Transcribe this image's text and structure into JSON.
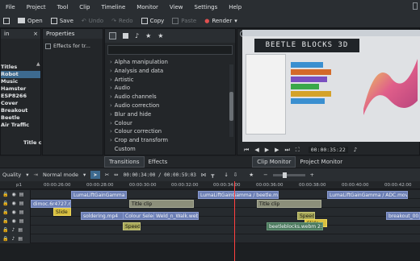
{
  "menu": [
    "File",
    "Project",
    "Tool",
    "Clip",
    "Timeline",
    "Monitor",
    "View",
    "Settings",
    "Help"
  ],
  "toolbar": {
    "open": "Open",
    "save": "Save",
    "undo": "Undo",
    "redo": "Redo",
    "copy": "Copy",
    "paste": "Paste",
    "render": "Render"
  },
  "bin": {
    "title": "in",
    "items": [
      "Titles",
      "Robot",
      "Music",
      "Hamster",
      "ESP8266",
      "Cover",
      "Breakout",
      "Beetle",
      "Air Traffic"
    ],
    "selected_index": 1,
    "title_clip": "Title cl"
  },
  "properties": {
    "title": "Properties",
    "effects_checkbox_label": "Effects for tr..."
  },
  "effects": {
    "items": [
      "Alpha manipulation",
      "Analysis and data",
      "Artistic",
      "Audio",
      "Audio channels",
      "Audio correction",
      "Blur and hide",
      "Colour",
      "Colour correction",
      "Crop and transform",
      "Custom"
    ],
    "tabs": [
      "Transitions",
      "Effects"
    ]
  },
  "monitor": {
    "banner": "BEETLE BLOCKS 3D",
    "timecode": "00:00:35:22",
    "tabs": [
      "Clip Monitor",
      "Project Monitor"
    ]
  },
  "timeline": {
    "quality": "Quality",
    "mode": "Normal mode",
    "position": "00:00:34:00 / 00:00:59:03",
    "ruler": [
      "00:00:26:00",
      "00:00:28:00",
      "00:00:30:00",
      "00:00:32:00",
      "00:00:34:00",
      "00:00:36:00",
      "00:00:38:00",
      "00:00:40:00",
      "00:00:42:00",
      "00:00:44:00"
    ],
    "clips_v2": [
      "LumaLiftGainGamma / esp8266.mov",
      "LumaLiftGainGamma / beetle.mov",
      "LumaLiftGainGamma / ADC.mov"
    ],
    "clips_v1_titles": [
      "Title clip",
      "Title clip"
    ],
    "clips_v1": [
      "dimoc.6r4727.mp4",
      "Slide",
      "soldering.mp4",
      "Colour Selectio",
      "Weld_n_Walk.webm",
      "Speed",
      "Slide",
      "breakout_00.webm"
    ],
    "clips_a": [
      "Speed",
      "beetleblocks.webm 2:16"
    ]
  },
  "colors": {
    "accent": "#3d6a8f",
    "playhead": "#ff4040"
  }
}
